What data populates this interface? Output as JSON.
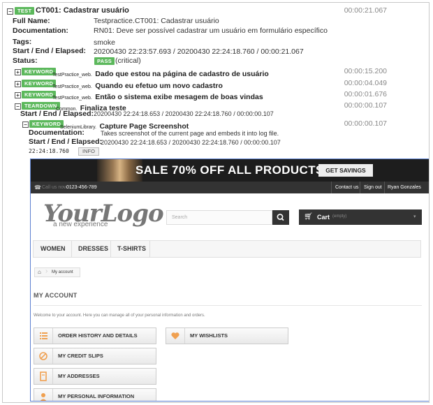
{
  "test": {
    "badge": "TEST",
    "title": "CT001: Cadastrar usuário",
    "elapsed": "00:00:21.067",
    "full_name_label": "Full Name:",
    "full_name": "Testpractice.CT001: Cadastrar usuário",
    "documentation_label": "Documentation:",
    "documentation": "RN01: Deve ser possível cadastrar um usuário em formulário específico",
    "tags_label": "Tags:",
    "tags": "smoke",
    "times_label": "Start / End / Elapsed:",
    "times": "20200430 22:23:57.693 / 20200430 22:24:18.760 / 00:00:21.067",
    "status_label": "Status:",
    "status_badge": "PASS",
    "status_note": "(critical)"
  },
  "keywords": [
    {
      "badge": "KEYWORD",
      "lib": "TestPractice_web.",
      "name": "Dado que estou na página de cadastro de usuário",
      "elapsed": "00:00:15.200"
    },
    {
      "badge": "KEYWORD",
      "lib": "TestPractice_web.",
      "name": "Quando eu efetuo um novo cadastro",
      "elapsed": "00:00:04.049"
    },
    {
      "badge": "KEYWORD",
      "lib": "TestPractice_web.",
      "name": "Então o sistema exibe mesagem de boas vindas",
      "elapsed": "00:00:01.676"
    }
  ],
  "teardown": {
    "badge": "TEARDOWN",
    "lib": "Common.",
    "name": "Finaliza teste",
    "elapsed": "00:00:00.107",
    "times_label": "Start / End / Elapsed:",
    "times": "20200430 22:24:18.653 / 20200430 22:24:18.760 / 00:00:00.107",
    "keyword": {
      "badge": "KEYWORD",
      "lib": "SeleniumLibrary.",
      "name": "Capture Page Screenshot",
      "elapsed": "00:00:00.107",
      "documentation_label": "Documentation:",
      "documentation": "Takes screenshot of the current page and embeds it into log file.",
      "times_label": "Start / End / Elapsed:",
      "times": "20200430 22:24:18.653 / 20200430 22:24:18.760 / 00:00:00.107",
      "log_time": "22:24:18.760",
      "log_level": "INFO"
    }
  },
  "screenshot": {
    "banner_text": "SALE 70% OFF ALL PRODUCTS",
    "banner_button": "GET SAVINGS NOW",
    "call_us": "Call us now:",
    "phone": "0123-456-789",
    "nav_contact": "Contact us",
    "nav_signout": "Sign out",
    "nav_user": "Ryan Gonzales",
    "logo": "YourLogo",
    "logo_sub": "a new experience",
    "search_placeholder": "Search",
    "cart_label": "Cart",
    "cart_empty": "(empty)",
    "menu": [
      "WOMEN",
      "DRESSES",
      "T-SHIRTS"
    ],
    "breadcrumb": "My account",
    "title": "MY ACCOUNT",
    "welcome": "Welcome to your account. Here you can manage all of your personal information and orders.",
    "buttons_left": [
      "ORDER HISTORY AND DETAILS",
      "MY CREDIT SLIPS",
      "MY ADDRESSES",
      "MY PERSONAL INFORMATION"
    ],
    "button_right": "MY WISHLISTS",
    "accent_color": "#f0a050"
  }
}
